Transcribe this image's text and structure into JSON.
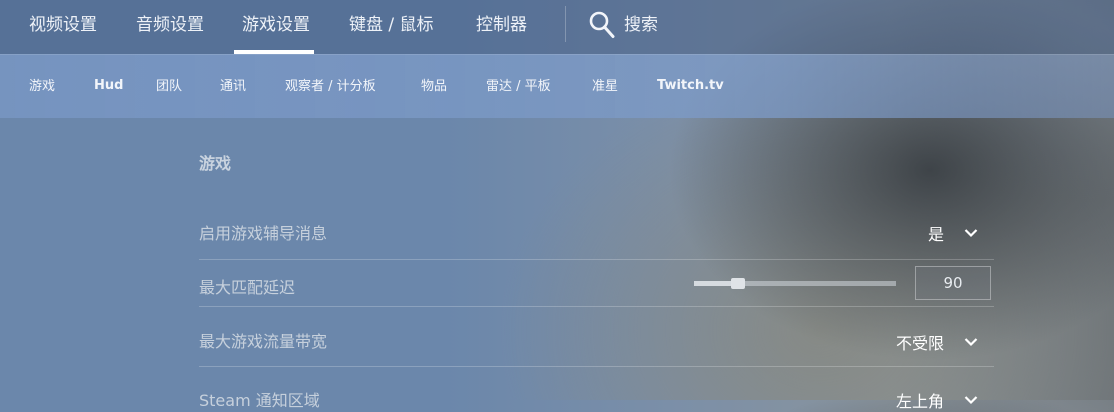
{
  "top_tabs": [
    {
      "label": "视频设置"
    },
    {
      "label": "音频设置"
    },
    {
      "label": "游戏设置",
      "active": true
    },
    {
      "label": "键盘 / 鼠标"
    },
    {
      "label": "控制器"
    }
  ],
  "search": {
    "label": "搜索",
    "icon": "search-icon"
  },
  "sub_tabs": [
    {
      "label": "游戏"
    },
    {
      "label": "Hud"
    },
    {
      "label": "团队"
    },
    {
      "label": "通讯"
    },
    {
      "label": "观察者 / 计分板"
    },
    {
      "label": "物品"
    },
    {
      "label": "雷达 / 平板"
    },
    {
      "label": "准星"
    },
    {
      "label": "Twitch.tv"
    }
  ],
  "section": {
    "title": "游戏"
  },
  "settings": [
    {
      "label": "启用游戏辅导消息",
      "value": "是"
    },
    {
      "label": "最大匹配延迟",
      "value": "90",
      "slider_fraction": 0.22
    },
    {
      "label": "最大游戏流量带宽",
      "value": "不受限"
    },
    {
      "label": "Steam 通知区域",
      "value": "左上角"
    }
  ],
  "colors": {
    "accent_underline": "#ffffff",
    "chevron": "#ffffff"
  }
}
